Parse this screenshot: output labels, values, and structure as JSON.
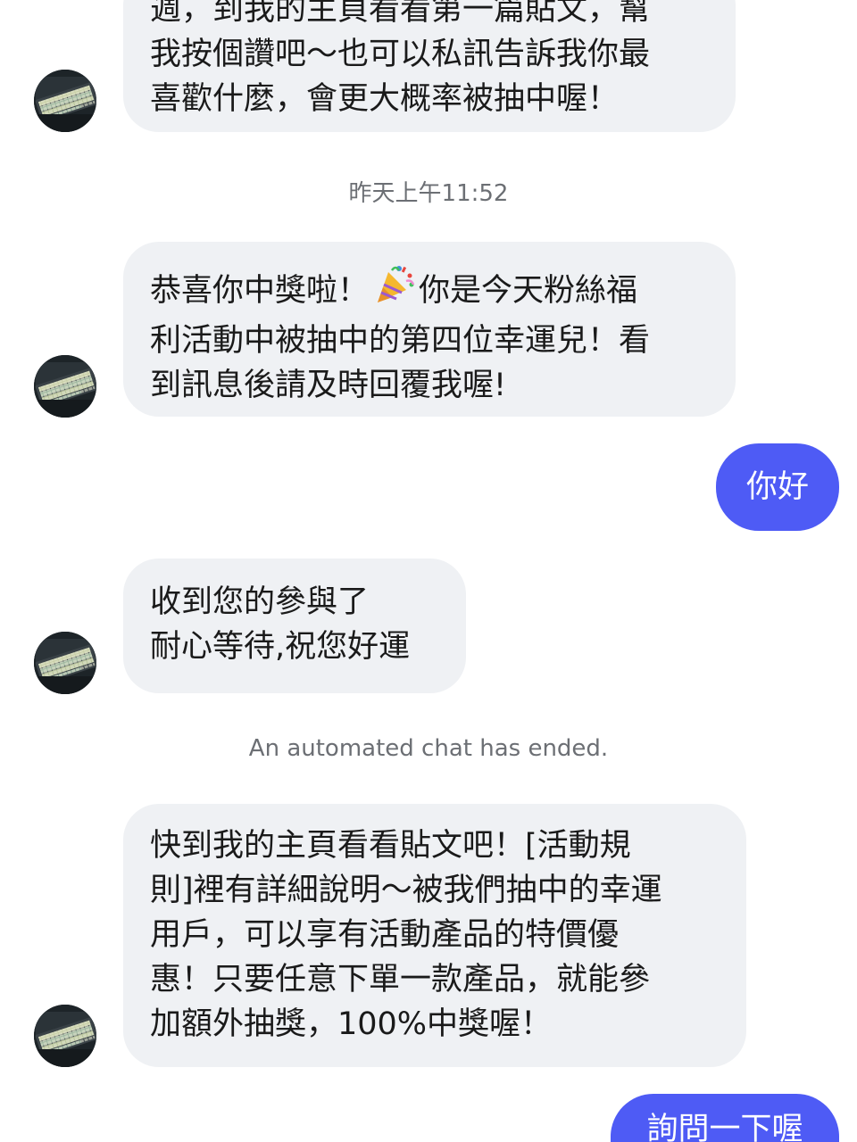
{
  "messages": {
    "m1": {
      "lines": [
        "週，到我的主頁看看第一篇貼文，幫",
        "我按個讚吧～也可以私訊告訴我你最",
        "喜歡什麼，會更大概率被抽中喔！"
      ]
    },
    "timestamp": "昨天上午11:52",
    "m2": {
      "line1_before": "恭喜你中獎啦！",
      "emoji": "party-popper-icon",
      "line1_after": "你是今天粉絲福",
      "line2": "利活動中被抽中的第四位幸運兒！看",
      "line3": "到訊息後請及時回覆我喔!"
    },
    "m3": {
      "text": "你好"
    },
    "m4": {
      "lines": [
        "收到您的參與了",
        "耐心等待,祝您好運"
      ]
    },
    "system_note": "An automated chat has ended.",
    "m5": {
      "lines": [
        "快到我的主頁看看貼文吧！[活動規",
        "則]裡有詳細說明～被我們抽中的幸運",
        "用戶，可以享有活動產品的特價優",
        "惠！只要任意下單一款產品，就能參",
        "加額外抽獎，100%中獎喔！"
      ]
    },
    "m6": {
      "text": "詢問一下喔"
    }
  },
  "colors": {
    "incoming_bubble": "#eff1f4",
    "outgoing_bubble": "#4e5bf5",
    "meta_text": "#6c6f74"
  }
}
